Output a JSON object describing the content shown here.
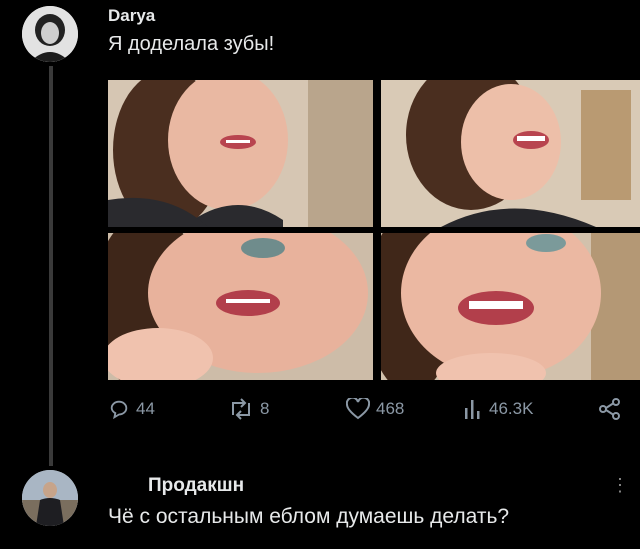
{
  "post": {
    "author": "Darya",
    "text": "Я доделала зубы!",
    "stats": {
      "replies": "44",
      "reposts": "8",
      "likes": "468",
      "views": "46.3K"
    }
  },
  "reply": {
    "author": "Продакшн",
    "text": "Чё с остальным еблом думаешь делать?"
  },
  "icons": [
    "reply-icon",
    "repost-icon",
    "like-icon",
    "views-icon",
    "share-icon",
    "more-icon"
  ],
  "colors": {
    "background": "#000000",
    "text": "#e7e9ea",
    "muted": "#8b98a5"
  }
}
